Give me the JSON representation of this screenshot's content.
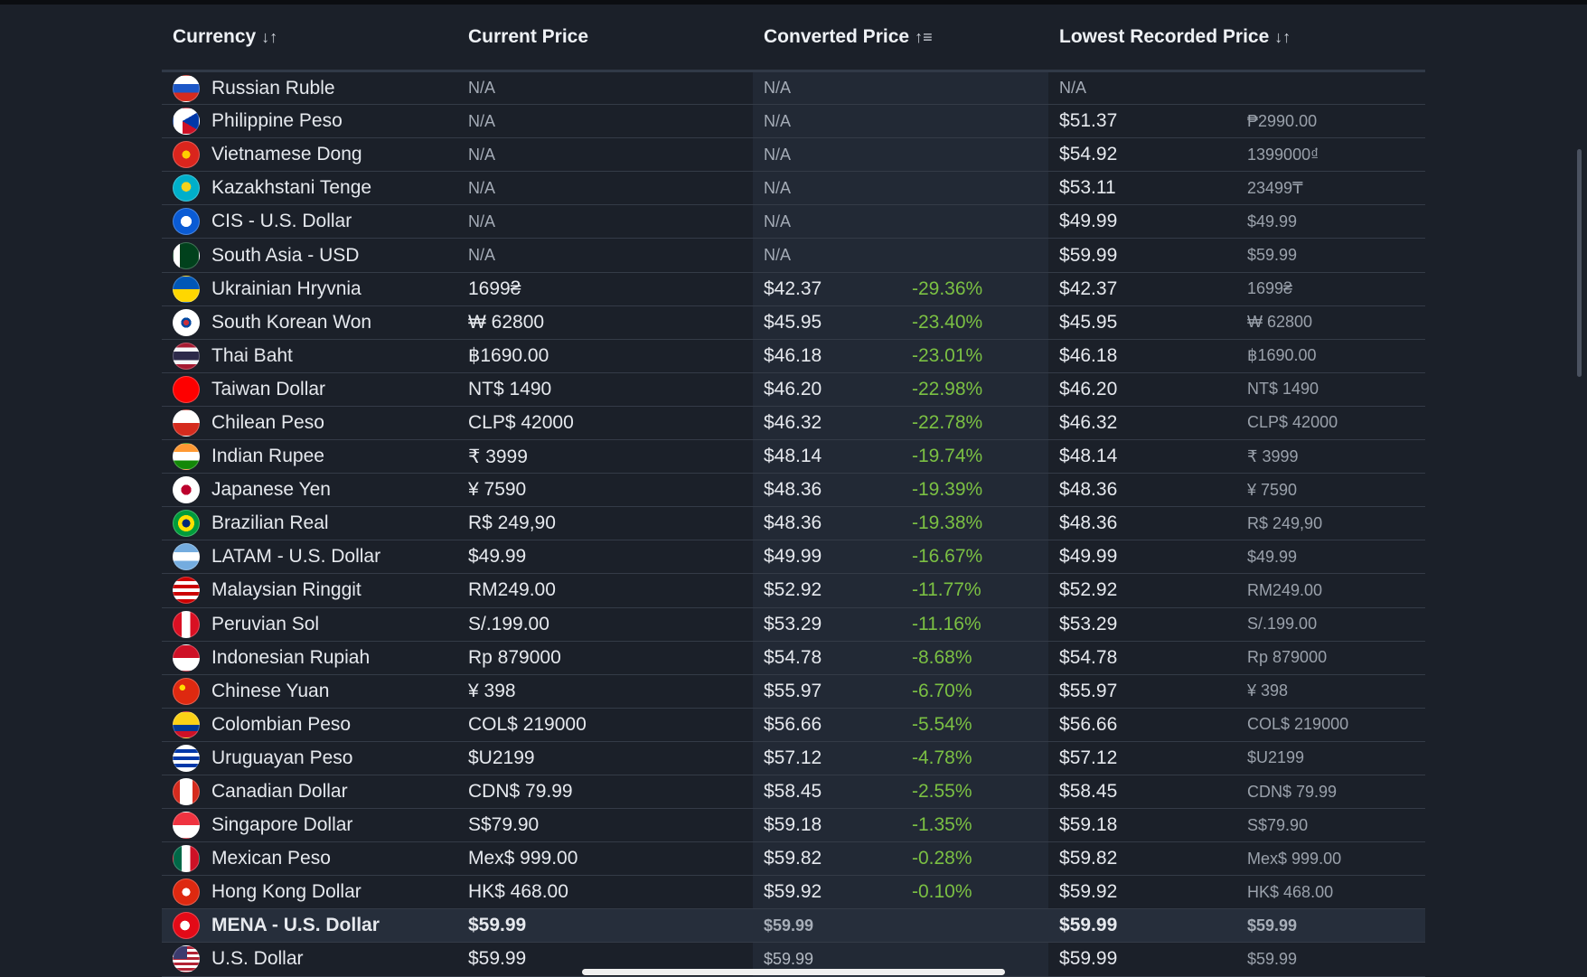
{
  "headers": {
    "currency": "Currency",
    "current_price": "Current Price",
    "converted_price": "Converted Price",
    "lowest_recorded_price": "Lowest Recorded Price"
  },
  "sort_icons": {
    "currency": "↓↑",
    "converted_price": "↑≡",
    "lowest_recorded_price": "↓↑"
  },
  "rows": [
    {
      "name": "Russian Ruble",
      "flag": "ru",
      "current": "N/A",
      "converted": "N/A",
      "pct": "",
      "lowest": "N/A",
      "lowest_local": ""
    },
    {
      "name": "Philippine Peso",
      "flag": "ph",
      "current": "N/A",
      "converted": "N/A",
      "pct": "",
      "lowest": "$51.37",
      "lowest_local": "₱2990.00"
    },
    {
      "name": "Vietnamese Dong",
      "flag": "vn",
      "current": "N/A",
      "converted": "N/A",
      "pct": "",
      "lowest": "$54.92",
      "lowest_local": "1399000₫"
    },
    {
      "name": "Kazakhstani Tenge",
      "flag": "kz",
      "current": "N/A",
      "converted": "N/A",
      "pct": "",
      "lowest": "$53.11",
      "lowest_local": "23499₸"
    },
    {
      "name": "CIS - U.S. Dollar",
      "flag": "cis",
      "current": "N/A",
      "converted": "N/A",
      "pct": "",
      "lowest": "$49.99",
      "lowest_local": "$49.99"
    },
    {
      "name": "South Asia - USD",
      "flag": "pk",
      "current": "N/A",
      "converted": "N/A",
      "pct": "",
      "lowest": "$59.99",
      "lowest_local": "$59.99"
    },
    {
      "name": "Ukrainian Hryvnia",
      "flag": "ua",
      "current": "1699₴",
      "converted": "$42.37",
      "pct": "-29.36%",
      "lowest": "$42.37",
      "lowest_local": "1699₴"
    },
    {
      "name": "South Korean Won",
      "flag": "kr",
      "current": "₩ 62800",
      "converted": "$45.95",
      "pct": "-23.40%",
      "lowest": "$45.95",
      "lowest_local": "₩ 62800"
    },
    {
      "name": "Thai Baht",
      "flag": "th",
      "current": "฿1690.00",
      "converted": "$46.18",
      "pct": "-23.01%",
      "lowest": "$46.18",
      "lowest_local": "฿1690.00"
    },
    {
      "name": "Taiwan Dollar",
      "flag": "tw",
      "current": "NT$ 1490",
      "converted": "$46.20",
      "pct": "-22.98%",
      "lowest": "$46.20",
      "lowest_local": "NT$ 1490"
    },
    {
      "name": "Chilean Peso",
      "flag": "cl",
      "current": "CLP$ 42000",
      "converted": "$46.32",
      "pct": "-22.78%",
      "lowest": "$46.32",
      "lowest_local": "CLP$ 42000"
    },
    {
      "name": "Indian Rupee",
      "flag": "in",
      "current": "₹ 3999",
      "converted": "$48.14",
      "pct": "-19.74%",
      "lowest": "$48.14",
      "lowest_local": "₹ 3999"
    },
    {
      "name": "Japanese Yen",
      "flag": "jp",
      "current": "¥ 7590",
      "converted": "$48.36",
      "pct": "-19.39%",
      "lowest": "$48.36",
      "lowest_local": "¥ 7590"
    },
    {
      "name": "Brazilian Real",
      "flag": "br",
      "current": "R$ 249,90",
      "converted": "$48.36",
      "pct": "-19.38%",
      "lowest": "$48.36",
      "lowest_local": "R$ 249,90"
    },
    {
      "name": "LATAM - U.S. Dollar",
      "flag": "ar",
      "current": "$49.99",
      "converted": "$49.99",
      "pct": "-16.67%",
      "lowest": "$49.99",
      "lowest_local": "$49.99"
    },
    {
      "name": "Malaysian Ringgit",
      "flag": "my",
      "current": "RM249.00",
      "converted": "$52.92",
      "pct": "-11.77%",
      "lowest": "$52.92",
      "lowest_local": "RM249.00"
    },
    {
      "name": "Peruvian Sol",
      "flag": "pe",
      "current": "S/.199.00",
      "converted": "$53.29",
      "pct": "-11.16%",
      "lowest": "$53.29",
      "lowest_local": "S/.199.00"
    },
    {
      "name": "Indonesian Rupiah",
      "flag": "id",
      "current": "Rp 879000",
      "converted": "$54.78",
      "pct": "-8.68%",
      "lowest": "$54.78",
      "lowest_local": "Rp 879000"
    },
    {
      "name": "Chinese Yuan",
      "flag": "cn",
      "current": "¥ 398",
      "converted": "$55.97",
      "pct": "-6.70%",
      "lowest": "$55.97",
      "lowest_local": "¥ 398"
    },
    {
      "name": "Colombian Peso",
      "flag": "co",
      "current": "COL$ 219000",
      "converted": "$56.66",
      "pct": "-5.54%",
      "lowest": "$56.66",
      "lowest_local": "COL$ 219000"
    },
    {
      "name": "Uruguayan Peso",
      "flag": "uy",
      "current": "$U2199",
      "converted": "$57.12",
      "pct": "-4.78%",
      "lowest": "$57.12",
      "lowest_local": "$U2199"
    },
    {
      "name": "Canadian Dollar",
      "flag": "ca",
      "current": "CDN$ 79.99",
      "converted": "$58.45",
      "pct": "-2.55%",
      "lowest": "$58.45",
      "lowest_local": "CDN$ 79.99"
    },
    {
      "name": "Singapore Dollar",
      "flag": "sg",
      "current": "S$79.90",
      "converted": "$59.18",
      "pct": "-1.35%",
      "lowest": "$59.18",
      "lowest_local": "S$79.90"
    },
    {
      "name": "Mexican Peso",
      "flag": "mx",
      "current": "Mex$ 999.00",
      "converted": "$59.82",
      "pct": "-0.28%",
      "lowest": "$59.82",
      "lowest_local": "Mex$ 999.00"
    },
    {
      "name": "Hong Kong Dollar",
      "flag": "hk",
      "current": "HK$ 468.00",
      "converted": "$59.92",
      "pct": "-0.10%",
      "lowest": "$59.92",
      "lowest_local": "HK$ 468.00"
    },
    {
      "name": "MENA - U.S. Dollar",
      "flag": "tr",
      "current": "$59.99",
      "converted": "$59.99",
      "pct": "",
      "lowest": "$59.99",
      "lowest_local": "$59.99",
      "highlight": true
    },
    {
      "name": "U.S. Dollar",
      "flag": "us",
      "current": "$59.99",
      "converted": "$59.99",
      "pct": "",
      "lowest": "$59.99",
      "lowest_local": "$59.99"
    }
  ],
  "colors": {
    "background": "#1b2029",
    "converted_column": "#222935",
    "percent_green": "#7bc043",
    "highlight_row": "#262e3b"
  }
}
